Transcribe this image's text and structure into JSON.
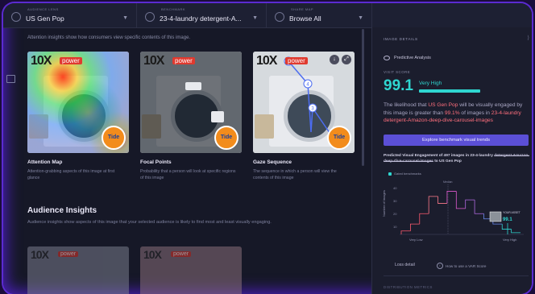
{
  "topbar": {
    "audience": {
      "caption": "Audience Lens",
      "value": "US Gen Pop"
    },
    "image": {
      "caption": "Benchmark",
      "value": "23-4-laundry detergent-A..."
    },
    "mode": {
      "caption": "Share map",
      "value": "Browse All"
    }
  },
  "main": {
    "intro": "Attention insights show how consumers view specific contents of this image.",
    "cards": [
      {
        "brand": "10X",
        "sub": "power",
        "title": "Attention Map",
        "desc": "Attention-grabbing aspects of this image at first glance"
      },
      {
        "brand": "10X",
        "sub": "power",
        "title": "Focal Points",
        "desc": "Probability that a person will look at specific regions of this image"
      },
      {
        "brand": "10X",
        "sub": "power",
        "title": "Gaze Sequence",
        "desc": "The sequence in which a person will view the contents of this image"
      }
    ],
    "tide_label": "Tide",
    "audience_title": "Audience Insights",
    "audience_desc": "Audience insights show aspects of this image that your selected audience is likely to find most and least visually engaging.",
    "audience_cards": [
      {
        "brand": "10X",
        "sub": "power"
      },
      {
        "brand": "10X",
        "sub": "power"
      }
    ]
  },
  "panel": {
    "title": "Image details",
    "predictive": "Predictive Analysis",
    "vs_label": "Visit score",
    "score": "99.1",
    "score_label": "Very High",
    "likelihood_pre": "The likelihood that ",
    "likelihood_aud": "US Gen Pop",
    "likelihood_mid": " will be visually engaged by this image is greater than ",
    "likelihood_pct": "99.1%",
    "likelihood_post": " of images in ",
    "likelihood_img": "23-4-laundry detergent-Amazon-deep-dive-carousel-images",
    "explore_button": "Explore benchmark visual trends",
    "pred_pre": "Predicted Visual Engagement of 497 images in 23-4-laundry ",
    "pred_strike": "detergent-Amazon-deep-dive-carousel-images",
    "pred_post": " to US Gen Pop",
    "legend": "Gated benchmarks",
    "loss_label": "Loss detail",
    "howto_label": "How to use a VAR Score",
    "bottom_label": "Distribution metrics",
    "accent": "#2fd6d0",
    "button_color": "#5b4fd6"
  },
  "chart_data": {
    "type": "line",
    "ylabel": "Number of Images",
    "ticks_y": [
      "40",
      "30",
      "20",
      "10"
    ],
    "x_left_label": "Very Low",
    "x_right_label": "Very High",
    "marker_label": "Median",
    "asset_label": "YOUR ASSET",
    "asset_value": "99.1",
    "series": [
      {
        "values": [
          2,
          6,
          12,
          22,
          18,
          25,
          15,
          20,
          12,
          9,
          6,
          3,
          1
        ]
      }
    ]
  }
}
